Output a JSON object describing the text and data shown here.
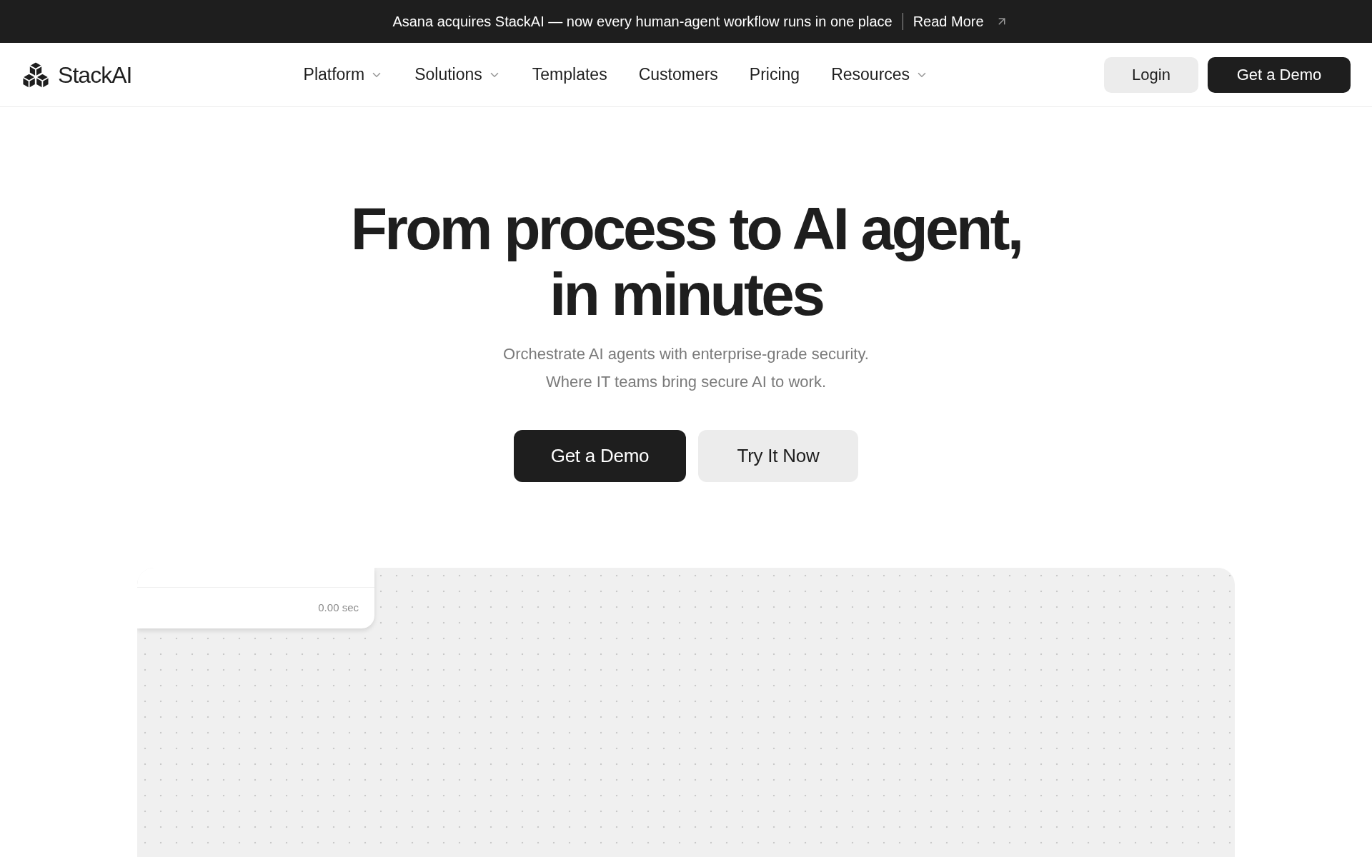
{
  "announcement": {
    "text": "Asana acquires StackAI — now every human-agent workflow runs in one place",
    "link": "Read More"
  },
  "nav": {
    "brand": "StackAI",
    "items": [
      {
        "label": "Platform",
        "has_menu": true
      },
      {
        "label": "Solutions",
        "has_menu": true
      },
      {
        "label": "Templates",
        "has_menu": false
      },
      {
        "label": "Customers",
        "has_menu": false
      },
      {
        "label": "Pricing",
        "has_menu": false
      },
      {
        "label": "Resources",
        "has_menu": true
      }
    ],
    "actions": [
      {
        "label": "Login",
        "kind": "secondary"
      },
      {
        "label": "Get a Demo",
        "kind": "primary"
      }
    ]
  },
  "hero": {
    "title_lines": [
      "From process to AI agent,",
      "in minutes"
    ],
    "subtitle_lines": [
      "Orchestrate AI agents with enterprise-grade security.",
      "Where IT teams bring secure AI to work."
    ],
    "buttons": [
      {
        "label": "Get a Demo",
        "kind": "primary"
      },
      {
        "label": "Try It Now",
        "kind": "secondary"
      }
    ]
  },
  "canvas": {
    "node": {
      "duration": "0.00 sec"
    }
  }
}
